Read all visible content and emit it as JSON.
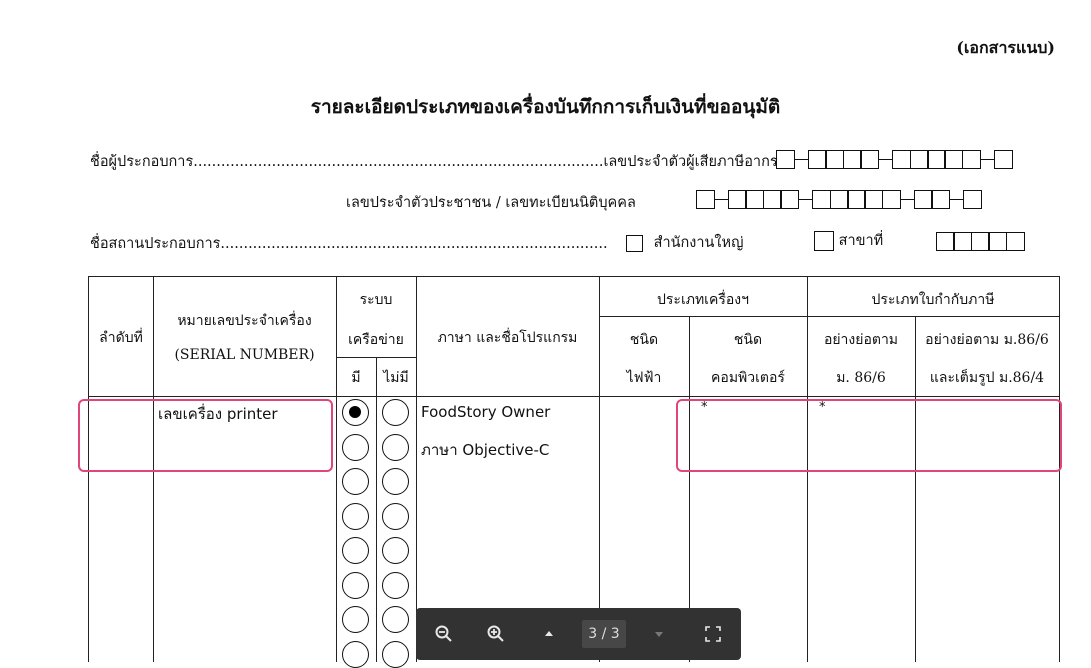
{
  "document": {
    "annex_label": "(เอกสารแนบ)",
    "title": "รายละเอียดประเภทของเครื่องบันทึกการเก็บเงินที่ขออนุมัติ",
    "operator_name_line": "ชื่อผู้ประกอบการ.........................................................................................เลขประจำตัวผู้เสียภาษีอากร",
    "citizen_id_label": "เลขประจำตัวประชาชน / เลขทะเบียนนิติบุคคล",
    "premises_line": "ชื่อสถานประกอบการ....................................................................................",
    "head_office_label": "สำนักงานใหญ่",
    "branch_label": "สาขาที่"
  },
  "table": {
    "headers": {
      "order": "ลำดับที่",
      "serial_line1": "หมายเลขประจำเครื่อง",
      "serial_line2": "(SERIAL NUMBER)",
      "network_line1": "ระบบ",
      "network_line2": "เครือข่าย",
      "network_yes": "มี",
      "network_no": "ไม่มี",
      "language_program": "ภาษา และชื่อโปรแกรม",
      "machine_type_group": "ประเภทเครื่องฯ",
      "electric_line1": "ชนิด",
      "electric_line2": "ไฟฟ้า",
      "computer_line1": "ชนิด",
      "computer_line2": "คอมพิวเตอร์",
      "invoice_group": "ประเภทใบกำกับภาษี",
      "abbr_line1": "อย่างย่อตาม",
      "abbr_line2": "ม. 86/6",
      "full_line1": "อย่างย่อตาม ม.86/6",
      "full_line2": "และเต็มรูป ม.86/4"
    },
    "row1": {
      "serial": "เลขเครื่อง printer",
      "program_name": "FoodStory Owner",
      "language": "ภาษา Objective-C",
      "computer_mark": "*",
      "abbr_mark": "*",
      "network_selected": "มี"
    }
  },
  "viewer_toolbar": {
    "page_indicator": "3 / 3",
    "icons": [
      "zoom-out-icon",
      "zoom-in-icon",
      "page-up-icon",
      "page-down-icon",
      "fullscreen-icon"
    ]
  },
  "colors": {
    "highlight": "#e0457b",
    "toolbar_bg": "#323232"
  }
}
